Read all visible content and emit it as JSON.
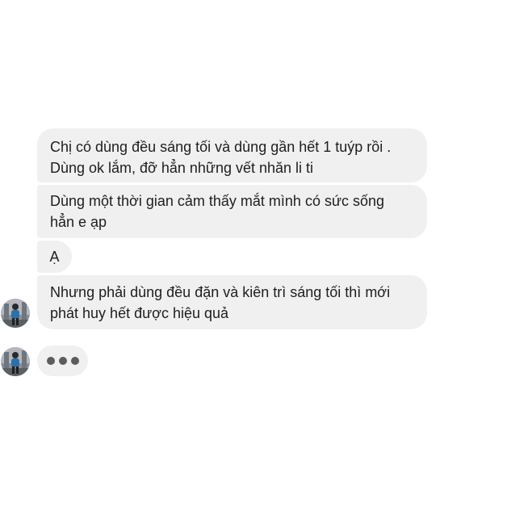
{
  "messages": [
    {
      "lines": [
        "Chị có dùng đều sáng tối và dùng gần hết 1 tuýp rồi .",
        "Dùng ok lắm, đỡ hẳn những vết nhăn li ti"
      ]
    },
    {
      "lines": [
        "Dùng một thời gian cảm thấy mắt mình có sức sống",
        "hẳn e ạp"
      ]
    },
    {
      "lines": [
        "Ạ"
      ]
    },
    {
      "lines": [
        "Nhưng phải dùng đều đặn và kiên trì sáng tối thì mới",
        "phát huy hết được hiệu quả"
      ]
    }
  ],
  "typing_indicator": {
    "icon": "typing-dots-icon"
  },
  "colors": {
    "bubble_bg": "#f0f0f0",
    "text": "#1c1e21",
    "typing_dot": "#5c5c5c"
  }
}
